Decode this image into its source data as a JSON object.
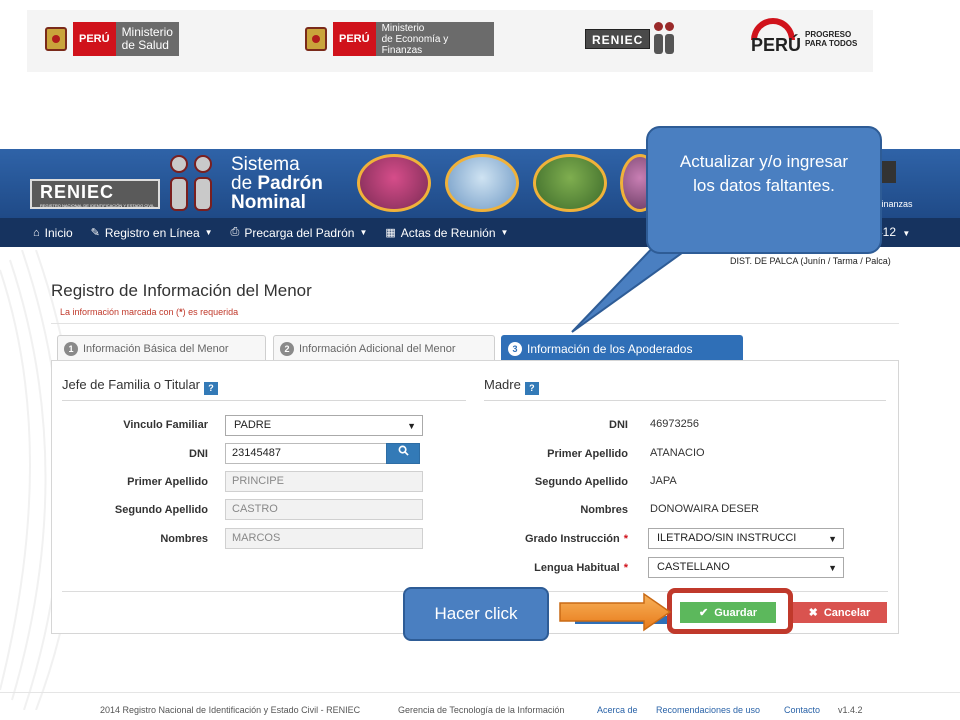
{
  "logos": {
    "salud": {
      "peru": "PERÚ",
      "line1": "Ministerio",
      "line2": "de Salud"
    },
    "economia": {
      "peru": "PERÚ",
      "line1": "Ministerio",
      "line2": "de Economía y Finanzas"
    },
    "reniec": "RENIEC",
    "peru_progreso": {
      "peru": "PERÚ",
      "line1": "PROGRESO",
      "line2": "PARA TODOS"
    }
  },
  "banner": {
    "reniec": "RENIEC",
    "reniec_subtitle": "REGISTRO NACIONAL DE IDENTIFICACIÓN Y ESTADO CIVIL",
    "title_line1": "Sistema",
    "title_line2_a": "de ",
    "title_line2_b": "Padrón",
    "title_line3": "Nominal",
    "finanzas": "Finanzas"
  },
  "navbar": {
    "items": [
      {
        "label": "Inicio",
        "icon": "home-icon"
      },
      {
        "label": "Registro en Línea",
        "icon": "pencil-icon"
      },
      {
        "label": "Precarga del Padrón",
        "icon": "print-icon"
      },
      {
        "label": "Actas de Reunión",
        "icon": "folder-icon"
      }
    ],
    "user": "412"
  },
  "district": "DIST. DE PALCA (Junín / Tarma / Palca)",
  "form": {
    "title": "Registro de Información del Menor",
    "required_note_a": "La información marcada con (",
    "required_note_star": "*",
    "required_note_b": ") es requerida",
    "tabs": [
      {
        "num": "1",
        "label": "Información Básica del Menor"
      },
      {
        "num": "2",
        "label": "Información Adicional del Menor"
      },
      {
        "num": "3",
        "label": "Información de los Apoderados"
      }
    ],
    "jefe": {
      "heading": "Jefe de Familia o Titular",
      "help": "?",
      "vinculo_label": "Vinculo Familiar",
      "vinculo_value": "PADRE",
      "dni_label": "DNI",
      "dni_value": "23145487",
      "primer_label": "Primer Apellido",
      "primer_value": "PRINCIPE",
      "segundo_label": "Segundo Apellido",
      "segundo_value": "CASTRO",
      "nombres_label": "Nombres",
      "nombres_value": "MARCOS"
    },
    "madre": {
      "heading": "Madre",
      "help": "?",
      "dni_label": "DNI",
      "dni_value": "46973256",
      "primer_label": "Primer Apellido",
      "primer_value": "ATANACIO",
      "segundo_label": "Segundo Apellido",
      "segundo_value": "JAPA",
      "nombres_label": "Nombres",
      "nombres_value": "DONOWAIRA DESER",
      "grado_label": "Grado Instrucción",
      "grado_value": "ILETRADO/SIN INSTRUCCI",
      "lengua_label": "Lengua Habitual",
      "lengua_value": "CASTELLANO"
    },
    "guardar": "Guardar",
    "cancelar": "Cancelar"
  },
  "callouts": {
    "actualizar": "Actualizar y/o ingresar los datos faltantes.",
    "click": "Hacer click"
  },
  "footer": {
    "copyright": "2014 Registro Nacional de Identificación y Estado Civil - RENIEC",
    "gerencia": "Gerencia de Tecnología de la Información",
    "acerca": "Acerca de",
    "recomendaciones": "Recomendaciones de uso",
    "contacto": "Contacto",
    "version": "v1.4.2"
  },
  "colors": {
    "banner": "#2f63a8",
    "navbar": "#16335f",
    "active_tab": "#2f6fb7",
    "guardar": "#5cb85c",
    "cancelar": "#d9534f",
    "callout": "#4a7fc1",
    "highlight": "#c0392b"
  }
}
